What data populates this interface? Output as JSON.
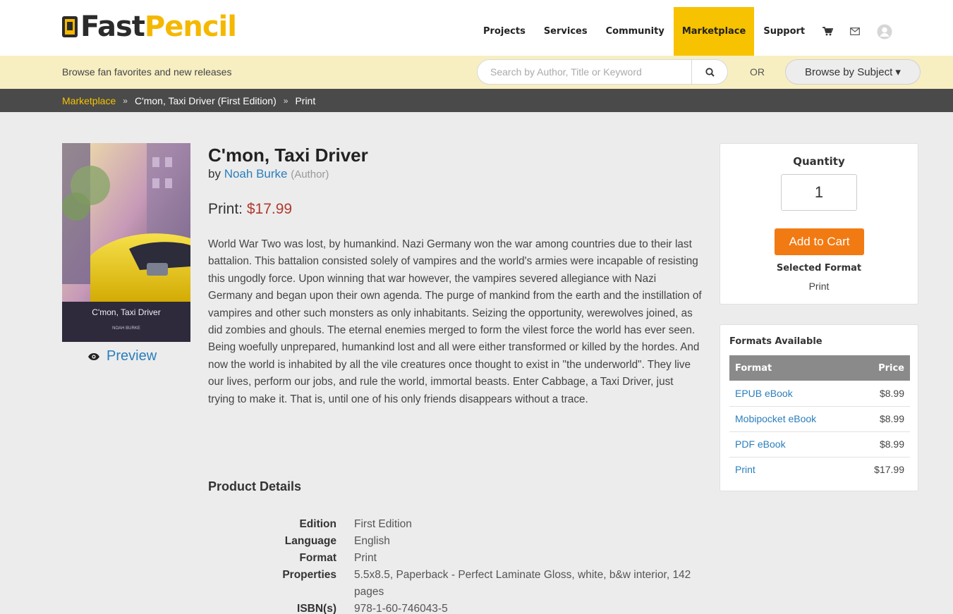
{
  "brand": {
    "name_part1": "Fast",
    "name_part2": "Pencil"
  },
  "nav": {
    "items": [
      "Projects",
      "Services",
      "Community",
      "Marketplace",
      "Support"
    ],
    "active": "Marketplace",
    "icons": [
      "cart-icon",
      "mail-icon",
      "user-avatar-icon"
    ]
  },
  "browse": {
    "text": "Browse fan favorites and new releases",
    "search_placeholder": "Search by Author, Title or Keyword",
    "or_text": "OR",
    "subject_button": "Browse by Subject ▾"
  },
  "breadcrumb": {
    "items": [
      "Marketplace",
      "C'mon, Taxi Driver (First Edition)",
      "Print"
    ],
    "separator": "»"
  },
  "cover": {
    "title": "C'mon, Taxi Driver",
    "author": "NOAH BURKE"
  },
  "preview_label": "Preview",
  "book": {
    "title": "C'mon, Taxi Driver",
    "by": "by",
    "author": "Noah Burke",
    "role": "(Author)",
    "price_label": "Print:",
    "price": "$17.99",
    "description": "World War Two was lost, by humankind. Nazi Germany won the war among countries due to their last battalion. This battalion consisted solely of vampires and the world's armies were incapable of resisting this ungodly force. Upon winning that war however, the vampires severed allegiance with Nazi Germany and began upon their own agenda. The purge of mankind from the earth and the instillation of vampires and other such monsters as only inhabitants. Seizing the opportunity, werewolves joined, as did zombies and ghouls. The eternal enemies merged to form the vilest force the world has ever seen. Being woefully unprepared, humankind lost and all were either transformed or killed by the hordes. And now the world is inhabited by all the vile creatures once thought to exist in \"the underworld\". They live our lives, perform our jobs, and rule the world, immortal beasts. Enter Cabbage, a Taxi Driver, just trying to make it. That is, until one of his only friends disappears without a trace."
  },
  "product_details": {
    "heading": "Product Details",
    "rows": [
      {
        "key": "Edition",
        "value": "First Edition"
      },
      {
        "key": "Language",
        "value": "English"
      },
      {
        "key": "Format",
        "value": "Print"
      },
      {
        "key": "Properties",
        "value": "5.5x8.5, Paperback - Perfect Laminate Gloss, white, b&w interior, 142 pages"
      },
      {
        "key": "ISBN(s)",
        "value": "978-1-60-746043-5"
      }
    ]
  },
  "purchase": {
    "quantity_label": "Quantity",
    "quantity_value": "1",
    "add_to_cart": "Add to Cart",
    "selected_format_label": "Selected Format",
    "selected_format": "Print"
  },
  "formats": {
    "title": "Formats Available",
    "header_format": "Format",
    "header_price": "Price",
    "rows": [
      {
        "format": "EPUB eBook",
        "price": "$8.99"
      },
      {
        "format": "Mobipocket eBook",
        "price": "$8.99"
      },
      {
        "format": "PDF eBook",
        "price": "$8.99"
      },
      {
        "format": "Print",
        "price": "$17.99"
      }
    ]
  },
  "colors": {
    "accent_yellow": "#f7c200",
    "link_blue": "#2a7ebc",
    "price_red": "#b03a2e",
    "cart_orange": "#f27a12",
    "breadcrumb_bg": "#4a4a4a",
    "browse_bg": "#f7efc2"
  }
}
